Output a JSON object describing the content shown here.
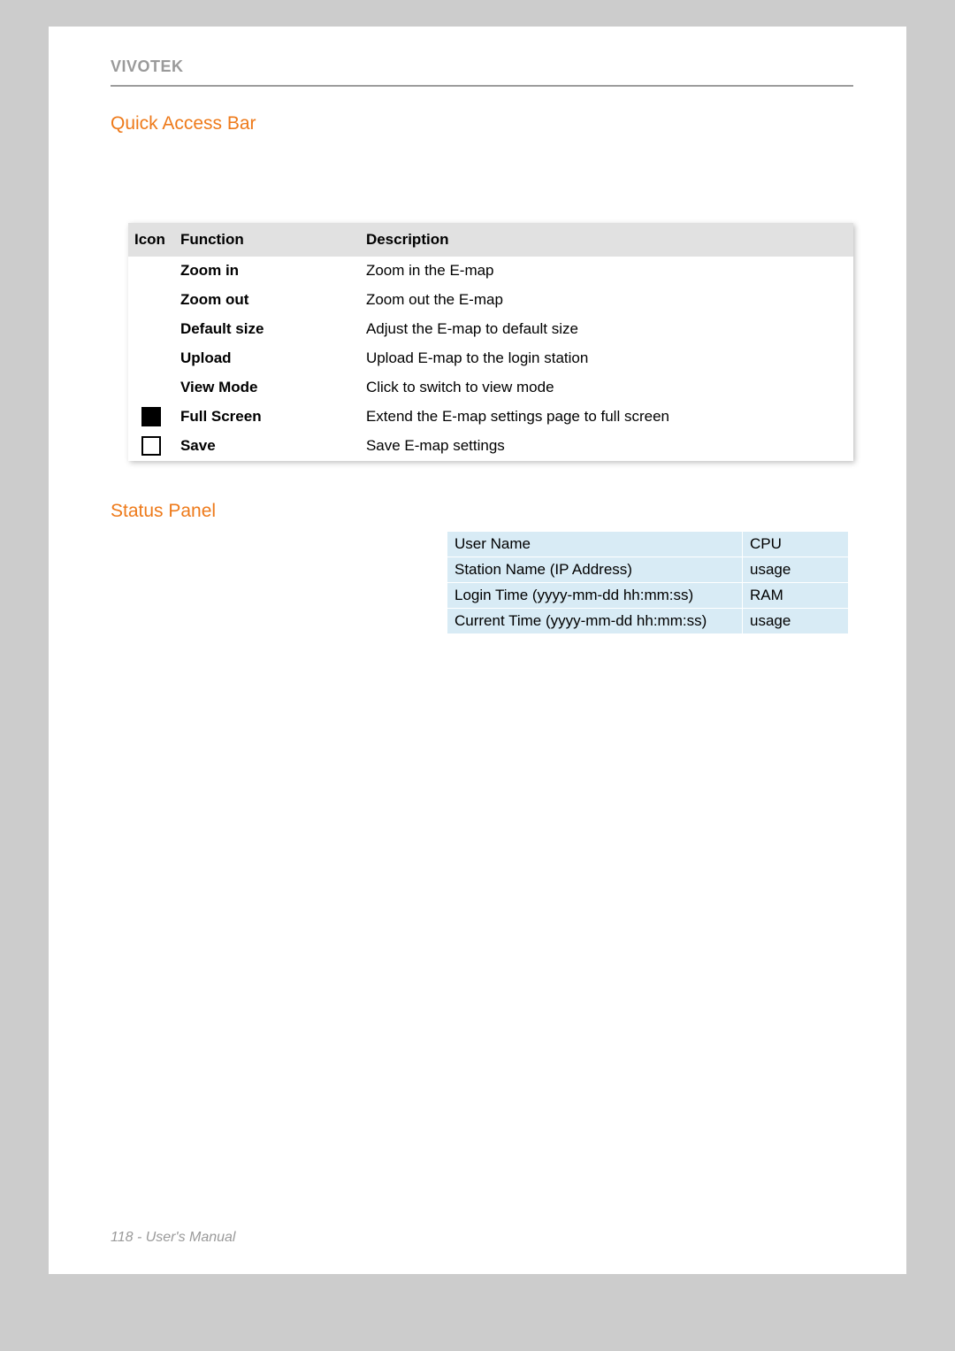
{
  "brand": "VIVOTEK",
  "sections": {
    "quick_access": "Quick Access Bar",
    "status_panel": "Status Panel"
  },
  "icon_table": {
    "headers": {
      "icon": "Icon",
      "function": "Function",
      "description": "Description"
    },
    "rows": [
      {
        "icon": "",
        "func": "Zoom in",
        "desc": "Zoom in the E-map"
      },
      {
        "icon": "",
        "func": "Zoom out",
        "desc": "Zoom out the E-map"
      },
      {
        "icon": "",
        "func": "Default size",
        "desc": "Adjust the E-map to default size"
      },
      {
        "icon": "",
        "func": "Upload",
        "desc": "Upload E-map to the login station"
      },
      {
        "icon": "",
        "func": "View Mode",
        "desc": "Click to switch to view mode"
      },
      {
        "icon": "filled",
        "func": "Full Screen",
        "desc": "Extend the E-map settings page to full screen"
      },
      {
        "icon": "outline",
        "func": "Save",
        "desc": "Save E-map settings"
      }
    ]
  },
  "status_table": {
    "rows": [
      {
        "left": "User Name",
        "right": "CPU"
      },
      {
        "left": "Station Name (IP Address)",
        "right": "usage"
      },
      {
        "left": "Login Time (yyyy-mm-dd hh:mm:ss)",
        "right": "RAM"
      },
      {
        "left": "Current Time (yyyy-mm-dd hh:mm:ss)",
        "right": "usage"
      }
    ]
  },
  "footer": "118 - User's Manual"
}
